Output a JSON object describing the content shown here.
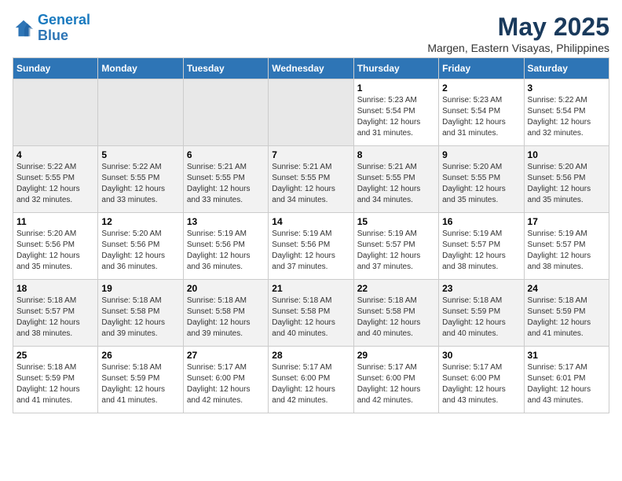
{
  "logo": {
    "line1": "General",
    "line2": "Blue"
  },
  "title": "May 2025",
  "subtitle": "Margen, Eastern Visayas, Philippines",
  "days_of_week": [
    "Sunday",
    "Monday",
    "Tuesday",
    "Wednesday",
    "Thursday",
    "Friday",
    "Saturday"
  ],
  "weeks": [
    [
      {
        "day": "",
        "info": ""
      },
      {
        "day": "",
        "info": ""
      },
      {
        "day": "",
        "info": ""
      },
      {
        "day": "",
        "info": ""
      },
      {
        "day": "1",
        "info": "Sunrise: 5:23 AM\nSunset: 5:54 PM\nDaylight: 12 hours\nand 31 minutes."
      },
      {
        "day": "2",
        "info": "Sunrise: 5:23 AM\nSunset: 5:54 PM\nDaylight: 12 hours\nand 31 minutes."
      },
      {
        "day": "3",
        "info": "Sunrise: 5:22 AM\nSunset: 5:54 PM\nDaylight: 12 hours\nand 32 minutes."
      }
    ],
    [
      {
        "day": "4",
        "info": "Sunrise: 5:22 AM\nSunset: 5:55 PM\nDaylight: 12 hours\nand 32 minutes."
      },
      {
        "day": "5",
        "info": "Sunrise: 5:22 AM\nSunset: 5:55 PM\nDaylight: 12 hours\nand 33 minutes."
      },
      {
        "day": "6",
        "info": "Sunrise: 5:21 AM\nSunset: 5:55 PM\nDaylight: 12 hours\nand 33 minutes."
      },
      {
        "day": "7",
        "info": "Sunrise: 5:21 AM\nSunset: 5:55 PM\nDaylight: 12 hours\nand 34 minutes."
      },
      {
        "day": "8",
        "info": "Sunrise: 5:21 AM\nSunset: 5:55 PM\nDaylight: 12 hours\nand 34 minutes."
      },
      {
        "day": "9",
        "info": "Sunrise: 5:20 AM\nSunset: 5:55 PM\nDaylight: 12 hours\nand 35 minutes."
      },
      {
        "day": "10",
        "info": "Sunrise: 5:20 AM\nSunset: 5:56 PM\nDaylight: 12 hours\nand 35 minutes."
      }
    ],
    [
      {
        "day": "11",
        "info": "Sunrise: 5:20 AM\nSunset: 5:56 PM\nDaylight: 12 hours\nand 35 minutes."
      },
      {
        "day": "12",
        "info": "Sunrise: 5:20 AM\nSunset: 5:56 PM\nDaylight: 12 hours\nand 36 minutes."
      },
      {
        "day": "13",
        "info": "Sunrise: 5:19 AM\nSunset: 5:56 PM\nDaylight: 12 hours\nand 36 minutes."
      },
      {
        "day": "14",
        "info": "Sunrise: 5:19 AM\nSunset: 5:56 PM\nDaylight: 12 hours\nand 37 minutes."
      },
      {
        "day": "15",
        "info": "Sunrise: 5:19 AM\nSunset: 5:57 PM\nDaylight: 12 hours\nand 37 minutes."
      },
      {
        "day": "16",
        "info": "Sunrise: 5:19 AM\nSunset: 5:57 PM\nDaylight: 12 hours\nand 38 minutes."
      },
      {
        "day": "17",
        "info": "Sunrise: 5:19 AM\nSunset: 5:57 PM\nDaylight: 12 hours\nand 38 minutes."
      }
    ],
    [
      {
        "day": "18",
        "info": "Sunrise: 5:18 AM\nSunset: 5:57 PM\nDaylight: 12 hours\nand 38 minutes."
      },
      {
        "day": "19",
        "info": "Sunrise: 5:18 AM\nSunset: 5:58 PM\nDaylight: 12 hours\nand 39 minutes."
      },
      {
        "day": "20",
        "info": "Sunrise: 5:18 AM\nSunset: 5:58 PM\nDaylight: 12 hours\nand 39 minutes."
      },
      {
        "day": "21",
        "info": "Sunrise: 5:18 AM\nSunset: 5:58 PM\nDaylight: 12 hours\nand 40 minutes."
      },
      {
        "day": "22",
        "info": "Sunrise: 5:18 AM\nSunset: 5:58 PM\nDaylight: 12 hours\nand 40 minutes."
      },
      {
        "day": "23",
        "info": "Sunrise: 5:18 AM\nSunset: 5:59 PM\nDaylight: 12 hours\nand 40 minutes."
      },
      {
        "day": "24",
        "info": "Sunrise: 5:18 AM\nSunset: 5:59 PM\nDaylight: 12 hours\nand 41 minutes."
      }
    ],
    [
      {
        "day": "25",
        "info": "Sunrise: 5:18 AM\nSunset: 5:59 PM\nDaylight: 12 hours\nand 41 minutes."
      },
      {
        "day": "26",
        "info": "Sunrise: 5:18 AM\nSunset: 5:59 PM\nDaylight: 12 hours\nand 41 minutes."
      },
      {
        "day": "27",
        "info": "Sunrise: 5:17 AM\nSunset: 6:00 PM\nDaylight: 12 hours\nand 42 minutes."
      },
      {
        "day": "28",
        "info": "Sunrise: 5:17 AM\nSunset: 6:00 PM\nDaylight: 12 hours\nand 42 minutes."
      },
      {
        "day": "29",
        "info": "Sunrise: 5:17 AM\nSunset: 6:00 PM\nDaylight: 12 hours\nand 42 minutes."
      },
      {
        "day": "30",
        "info": "Sunrise: 5:17 AM\nSunset: 6:00 PM\nDaylight: 12 hours\nand 43 minutes."
      },
      {
        "day": "31",
        "info": "Sunrise: 5:17 AM\nSunset: 6:01 PM\nDaylight: 12 hours\nand 43 minutes."
      }
    ]
  ]
}
